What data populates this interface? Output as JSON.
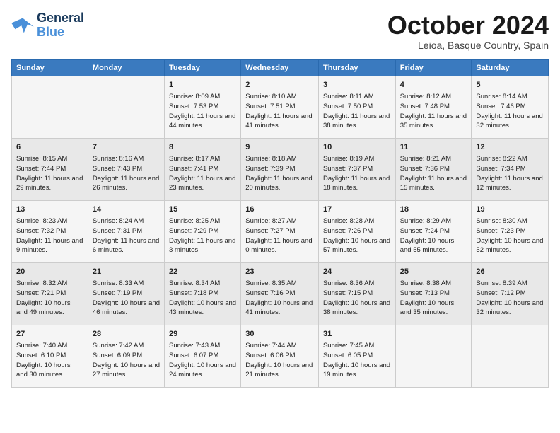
{
  "logo": {
    "line1": "General",
    "line2": "Blue"
  },
  "title": "October 2024",
  "subtitle": "Leioa, Basque Country, Spain",
  "days_of_week": [
    "Sunday",
    "Monday",
    "Tuesday",
    "Wednesday",
    "Thursday",
    "Friday",
    "Saturday"
  ],
  "weeks": [
    [
      {
        "day": "",
        "sunrise": "",
        "sunset": "",
        "daylight": ""
      },
      {
        "day": "",
        "sunrise": "",
        "sunset": "",
        "daylight": ""
      },
      {
        "day": "1",
        "sunrise": "Sunrise: 8:09 AM",
        "sunset": "Sunset: 7:53 PM",
        "daylight": "Daylight: 11 hours and 44 minutes."
      },
      {
        "day": "2",
        "sunrise": "Sunrise: 8:10 AM",
        "sunset": "Sunset: 7:51 PM",
        "daylight": "Daylight: 11 hours and 41 minutes."
      },
      {
        "day": "3",
        "sunrise": "Sunrise: 8:11 AM",
        "sunset": "Sunset: 7:50 PM",
        "daylight": "Daylight: 11 hours and 38 minutes."
      },
      {
        "day": "4",
        "sunrise": "Sunrise: 8:12 AM",
        "sunset": "Sunset: 7:48 PM",
        "daylight": "Daylight: 11 hours and 35 minutes."
      },
      {
        "day": "5",
        "sunrise": "Sunrise: 8:14 AM",
        "sunset": "Sunset: 7:46 PM",
        "daylight": "Daylight: 11 hours and 32 minutes."
      }
    ],
    [
      {
        "day": "6",
        "sunrise": "Sunrise: 8:15 AM",
        "sunset": "Sunset: 7:44 PM",
        "daylight": "Daylight: 11 hours and 29 minutes."
      },
      {
        "day": "7",
        "sunrise": "Sunrise: 8:16 AM",
        "sunset": "Sunset: 7:43 PM",
        "daylight": "Daylight: 11 hours and 26 minutes."
      },
      {
        "day": "8",
        "sunrise": "Sunrise: 8:17 AM",
        "sunset": "Sunset: 7:41 PM",
        "daylight": "Daylight: 11 hours and 23 minutes."
      },
      {
        "day": "9",
        "sunrise": "Sunrise: 8:18 AM",
        "sunset": "Sunset: 7:39 PM",
        "daylight": "Daylight: 11 hours and 20 minutes."
      },
      {
        "day": "10",
        "sunrise": "Sunrise: 8:19 AM",
        "sunset": "Sunset: 7:37 PM",
        "daylight": "Daylight: 11 hours and 18 minutes."
      },
      {
        "day": "11",
        "sunrise": "Sunrise: 8:21 AM",
        "sunset": "Sunset: 7:36 PM",
        "daylight": "Daylight: 11 hours and 15 minutes."
      },
      {
        "day": "12",
        "sunrise": "Sunrise: 8:22 AM",
        "sunset": "Sunset: 7:34 PM",
        "daylight": "Daylight: 11 hours and 12 minutes."
      }
    ],
    [
      {
        "day": "13",
        "sunrise": "Sunrise: 8:23 AM",
        "sunset": "Sunset: 7:32 PM",
        "daylight": "Daylight: 11 hours and 9 minutes."
      },
      {
        "day": "14",
        "sunrise": "Sunrise: 8:24 AM",
        "sunset": "Sunset: 7:31 PM",
        "daylight": "Daylight: 11 hours and 6 minutes."
      },
      {
        "day": "15",
        "sunrise": "Sunrise: 8:25 AM",
        "sunset": "Sunset: 7:29 PM",
        "daylight": "Daylight: 11 hours and 3 minutes."
      },
      {
        "day": "16",
        "sunrise": "Sunrise: 8:27 AM",
        "sunset": "Sunset: 7:27 PM",
        "daylight": "Daylight: 11 hours and 0 minutes."
      },
      {
        "day": "17",
        "sunrise": "Sunrise: 8:28 AM",
        "sunset": "Sunset: 7:26 PM",
        "daylight": "Daylight: 10 hours and 57 minutes."
      },
      {
        "day": "18",
        "sunrise": "Sunrise: 8:29 AM",
        "sunset": "Sunset: 7:24 PM",
        "daylight": "Daylight: 10 hours and 55 minutes."
      },
      {
        "day": "19",
        "sunrise": "Sunrise: 8:30 AM",
        "sunset": "Sunset: 7:23 PM",
        "daylight": "Daylight: 10 hours and 52 minutes."
      }
    ],
    [
      {
        "day": "20",
        "sunrise": "Sunrise: 8:32 AM",
        "sunset": "Sunset: 7:21 PM",
        "daylight": "Daylight: 10 hours and 49 minutes."
      },
      {
        "day": "21",
        "sunrise": "Sunrise: 8:33 AM",
        "sunset": "Sunset: 7:19 PM",
        "daylight": "Daylight: 10 hours and 46 minutes."
      },
      {
        "day": "22",
        "sunrise": "Sunrise: 8:34 AM",
        "sunset": "Sunset: 7:18 PM",
        "daylight": "Daylight: 10 hours and 43 minutes."
      },
      {
        "day": "23",
        "sunrise": "Sunrise: 8:35 AM",
        "sunset": "Sunset: 7:16 PM",
        "daylight": "Daylight: 10 hours and 41 minutes."
      },
      {
        "day": "24",
        "sunrise": "Sunrise: 8:36 AM",
        "sunset": "Sunset: 7:15 PM",
        "daylight": "Daylight: 10 hours and 38 minutes."
      },
      {
        "day": "25",
        "sunrise": "Sunrise: 8:38 AM",
        "sunset": "Sunset: 7:13 PM",
        "daylight": "Daylight: 10 hours and 35 minutes."
      },
      {
        "day": "26",
        "sunrise": "Sunrise: 8:39 AM",
        "sunset": "Sunset: 7:12 PM",
        "daylight": "Daylight: 10 hours and 32 minutes."
      }
    ],
    [
      {
        "day": "27",
        "sunrise": "Sunrise: 7:40 AM",
        "sunset": "Sunset: 6:10 PM",
        "daylight": "Daylight: 10 hours and 30 minutes."
      },
      {
        "day": "28",
        "sunrise": "Sunrise: 7:42 AM",
        "sunset": "Sunset: 6:09 PM",
        "daylight": "Daylight: 10 hours and 27 minutes."
      },
      {
        "day": "29",
        "sunrise": "Sunrise: 7:43 AM",
        "sunset": "Sunset: 6:07 PM",
        "daylight": "Daylight: 10 hours and 24 minutes."
      },
      {
        "day": "30",
        "sunrise": "Sunrise: 7:44 AM",
        "sunset": "Sunset: 6:06 PM",
        "daylight": "Daylight: 10 hours and 21 minutes."
      },
      {
        "day": "31",
        "sunrise": "Sunrise: 7:45 AM",
        "sunset": "Sunset: 6:05 PM",
        "daylight": "Daylight: 10 hours and 19 minutes."
      },
      {
        "day": "",
        "sunrise": "",
        "sunset": "",
        "daylight": ""
      },
      {
        "day": "",
        "sunrise": "",
        "sunset": "",
        "daylight": ""
      }
    ]
  ]
}
